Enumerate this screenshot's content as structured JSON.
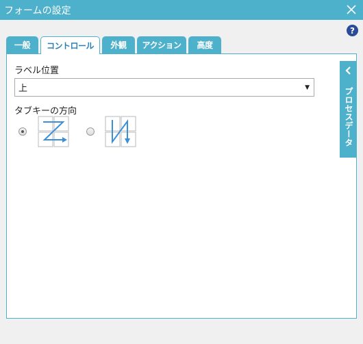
{
  "window": {
    "title": "フォームの設定"
  },
  "tabs": [
    {
      "label": "一般"
    },
    {
      "label": "コントロール"
    },
    {
      "label": "外観"
    },
    {
      "label": "アクション"
    },
    {
      "label": "高度"
    }
  ],
  "active_tab": "コントロール",
  "control": {
    "label_position": {
      "label": "ラベル位置",
      "selected": "上"
    },
    "tab_key_direction": {
      "label": "タブキーの方向",
      "selected": "horizontal"
    }
  },
  "side_panel": {
    "label": "プロセスデータ"
  },
  "colors": {
    "accent": "#4eb1cc",
    "help": "#2a4a9a",
    "active_tab_text": "#2b7fb8"
  }
}
